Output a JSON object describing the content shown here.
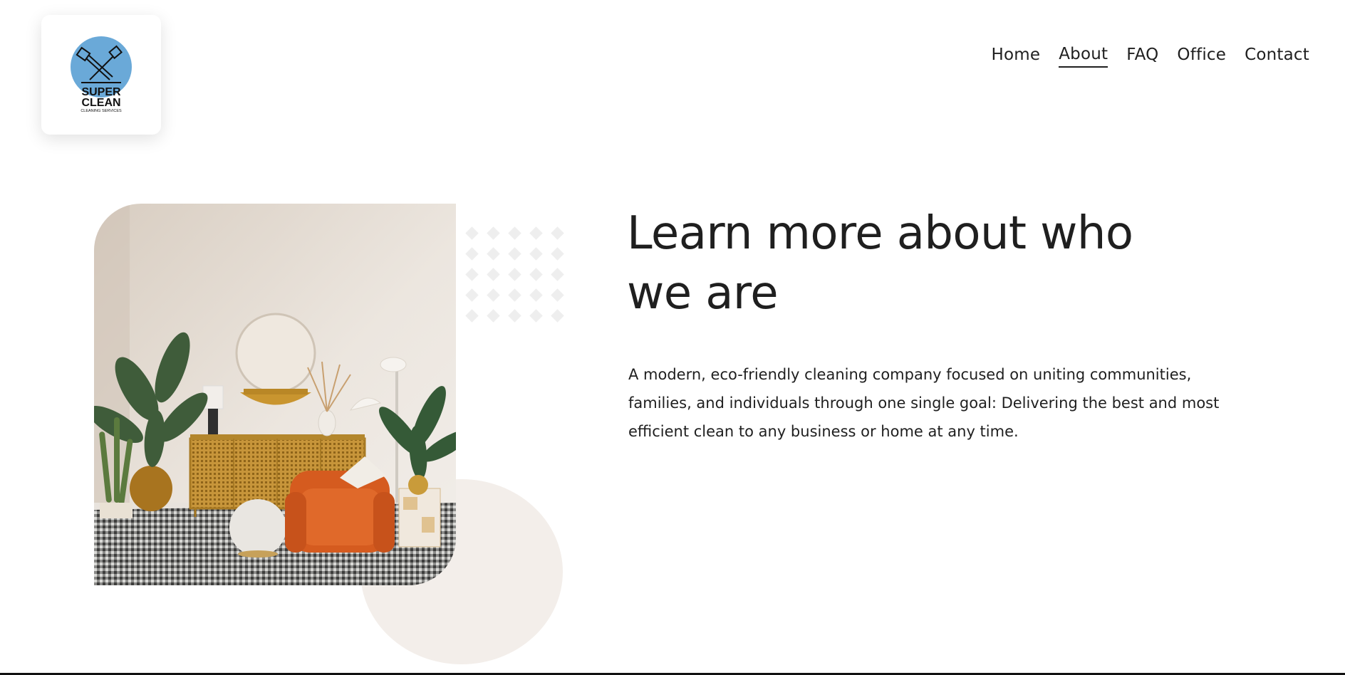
{
  "logo": {
    "line1": "SUPER",
    "line2": "CLEAN",
    "line3": "CLEANING SERVICES",
    "circle_color": "#6aa9d8"
  },
  "nav": [
    {
      "label": "Home",
      "active": false
    },
    {
      "label": "About",
      "active": true
    },
    {
      "label": "FAQ",
      "active": false
    },
    {
      "label": "Office",
      "active": false
    },
    {
      "label": "Contact",
      "active": false
    }
  ],
  "hero": {
    "headline": "Learn more about who we are",
    "body": "A modern, eco-friendly cleaning company focused on uniting communities, families, and individuals through one single goal: Delivering the best and most efficient clean to any business or home at any time."
  },
  "image": {
    "subject": "living room interior with orange armchair and plants"
  },
  "colors": {
    "text": "#1f1f1f",
    "accent_blob": "#f3eeea",
    "dot_pattern": "#eeeeee"
  }
}
